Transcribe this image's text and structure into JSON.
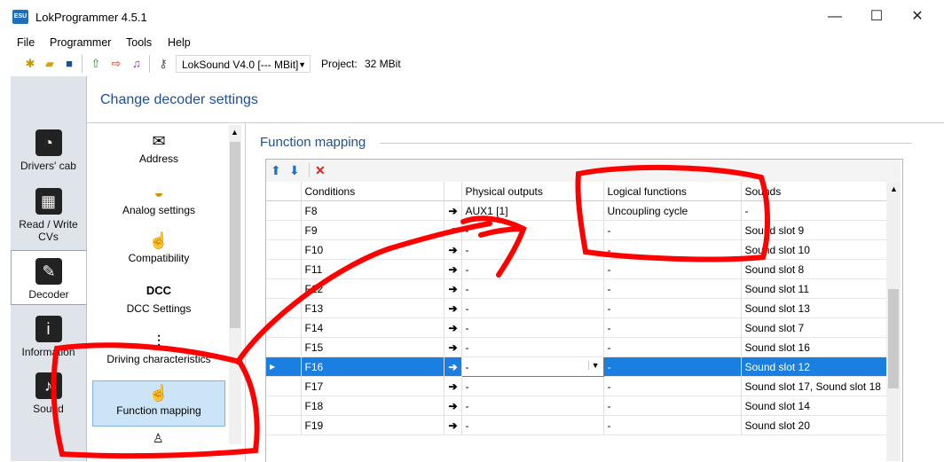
{
  "window": {
    "title": "LokProgrammer 4.5.1",
    "icon_label": "ESU",
    "controls": {
      "minimize": "—",
      "maximize": "☐",
      "close": "✕"
    }
  },
  "menu": [
    "File",
    "Programmer",
    "Tools",
    "Help"
  ],
  "toolbar": {
    "decoder": "LokSound V4.0 [--- MBit]",
    "project_label": "Project:",
    "project_size": "32 MBit"
  },
  "nav": {
    "items": [
      {
        "label": "Drivers' cab",
        "icon": "gauge-icon"
      },
      {
        "label": "Read / Write CVs",
        "icon": "chip-icon"
      },
      {
        "label": "Decoder",
        "icon": "wrench-icon",
        "active": true
      },
      {
        "label": "Information",
        "icon": "info-icon"
      },
      {
        "label": "Sound",
        "icon": "speaker-icon"
      }
    ]
  },
  "header": {
    "title": "Change decoder settings"
  },
  "categories": [
    {
      "label": "Address",
      "icon": "envelope-icon"
    },
    {
      "label": "Analog settings",
      "icon": "meter-icon"
    },
    {
      "label": "Compatibility",
      "icon": "hand-f-keys-icon"
    },
    {
      "label": "DCC Settings",
      "icon": "dcc-icon"
    },
    {
      "label": "Driving characteristics",
      "icon": "sliders-icon"
    },
    {
      "label": "Function mapping",
      "icon": "hand-f-keys-icon",
      "selected": true
    }
  ],
  "function_mapping": {
    "title": "Function mapping",
    "columns": [
      "Conditions",
      "Physical outputs",
      "Logical functions",
      "Sounds"
    ],
    "rows": [
      {
        "condition": "F8",
        "physical": "AUX1 [1]",
        "logical": "Uncoupling cycle",
        "sound": "-"
      },
      {
        "condition": "F9",
        "physical": "-",
        "logical": "-",
        "sound": "Sound slot 9"
      },
      {
        "condition": "F10",
        "physical": "-",
        "logical": "-",
        "sound": "Sound slot 10"
      },
      {
        "condition": "F11",
        "physical": "-",
        "logical": "-",
        "sound": "Sound slot 8"
      },
      {
        "condition": "F12",
        "physical": "-",
        "logical": "-",
        "sound": "Sound slot 11"
      },
      {
        "condition": "F13",
        "physical": "-",
        "logical": "-",
        "sound": "Sound slot 13"
      },
      {
        "condition": "F14",
        "physical": "-",
        "logical": "-",
        "sound": "Sound slot 7"
      },
      {
        "condition": "F15",
        "physical": "-",
        "logical": "-",
        "sound": "Sound slot 16"
      },
      {
        "condition": "F16",
        "physical": "-",
        "logical": "-",
        "sound": "Sound slot 12",
        "active": true
      },
      {
        "condition": "F17",
        "physical": "-",
        "logical": "-",
        "sound": "Sound slot 17, Sound slot 18"
      },
      {
        "condition": "F18",
        "physical": "-",
        "logical": "-",
        "sound": "Sound slot 14"
      },
      {
        "condition": "F19",
        "physical": "-",
        "logical": "-",
        "sound": "Sound slot 20"
      }
    ]
  },
  "colors": {
    "accent": "#1f4e9c",
    "selection": "#1a7fe0",
    "annotation": "#ff0000"
  }
}
